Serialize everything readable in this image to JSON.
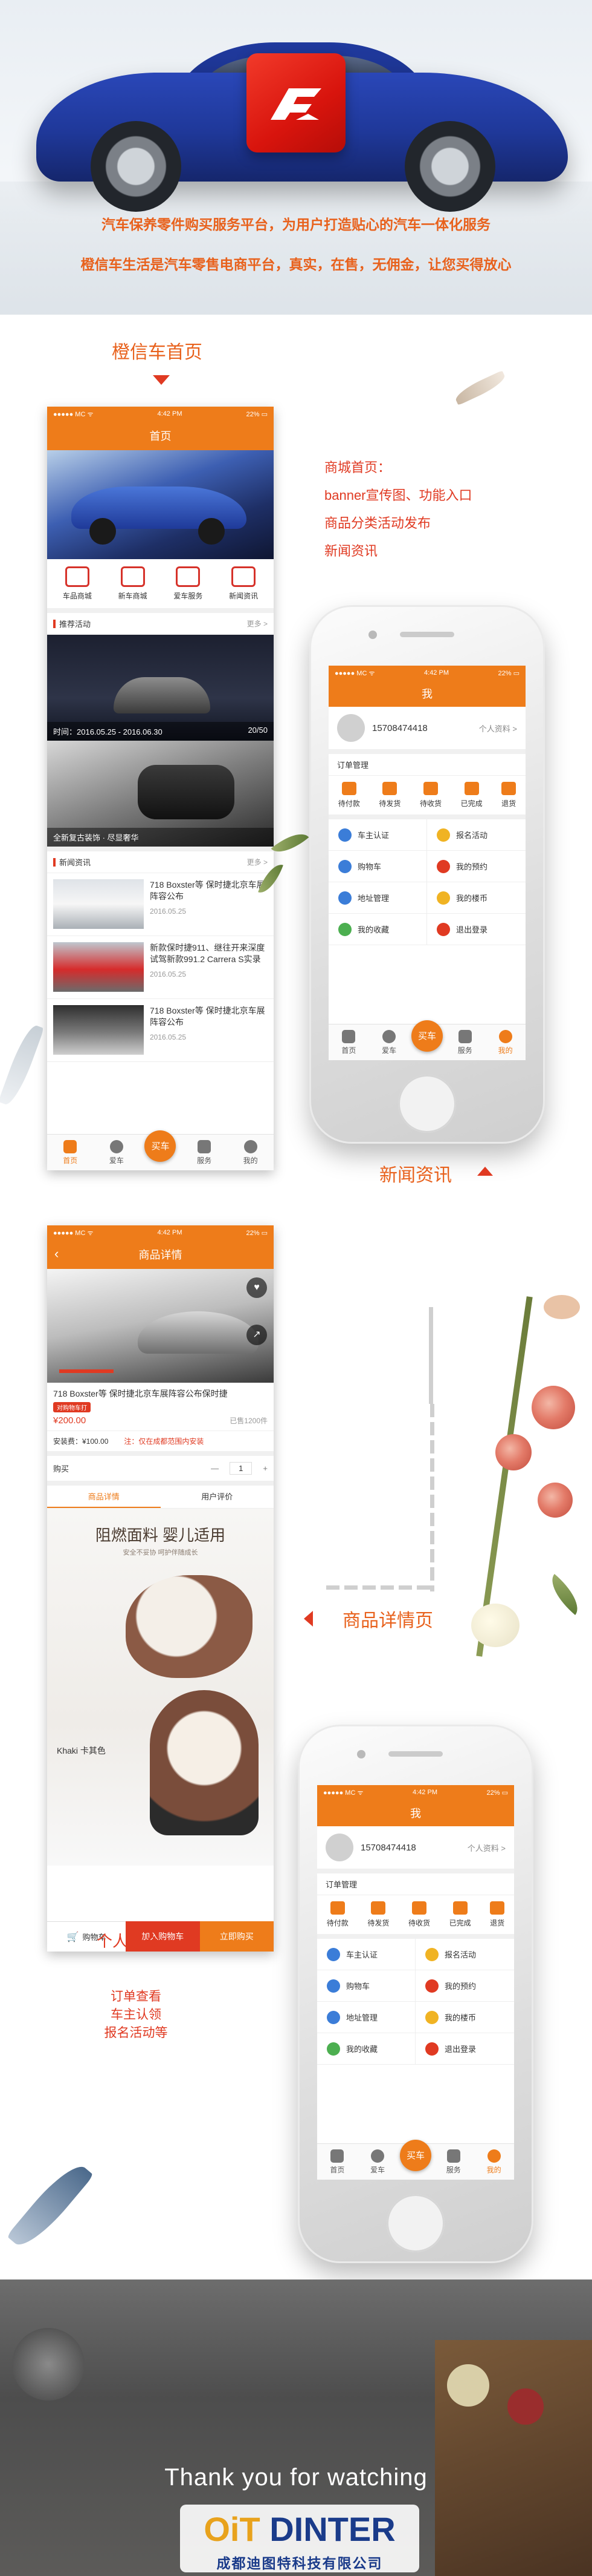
{
  "hero": {
    "line1": "汽车保养零件购买服务平台，为用户打造贴心的汽车一体化服务",
    "line2": "橙信车生活是汽车零售电商平台，真实，在售，无佣金，让您买得放心"
  },
  "section1": {
    "title": "橙信车首页",
    "desc": [
      "商城首页：",
      "banner宣传图、功能入口",
      "商品分类活动发布",
      "新闻资讯"
    ]
  },
  "home_screen": {
    "status_left": "●●●●● MC ᯤ",
    "status_time": "4:42 PM",
    "status_right": "22% ▭",
    "title": "首页",
    "quick": [
      "车品商城",
      "新车商城",
      "爱车服务",
      "新闻资讯"
    ],
    "promo_head": "推荐活动",
    "more": "更多 >",
    "promo1": {
      "caption": "时间：2016.05.25 - 2016.06.30",
      "count": "20/50"
    },
    "promo2": {
      "caption": "全新复古装饰 · 尽显奢华"
    },
    "news_head": "新闻资讯",
    "news": [
      {
        "title": "718 Boxster等 保时捷北京车展阵容公布",
        "date": "2016.05.25"
      },
      {
        "title": "新款保时捷911、继往开来深度试驾新款991.2 Carrera S实录",
        "date": "2016.05.25"
      },
      {
        "title": "718 Boxster等 保时捷北京车展阵容公布",
        "date": "2016.05.25"
      }
    ],
    "tabs": [
      "首页",
      "爱车",
      "买车",
      "服务",
      "我的"
    ]
  },
  "section2": {
    "title": "新闻资讯"
  },
  "profile_screen": {
    "status_left": "●●●●● MC ᯤ",
    "status_time": "4:42 PM",
    "status_right": "22% ▭",
    "title": "我",
    "phone": "15708474418",
    "profile_link": "个人资料 >",
    "orders_title": "订单管理",
    "orders": [
      "待付款",
      "待发货",
      "待收货",
      "已完成",
      "退货"
    ],
    "menu": [
      "车主认证",
      "报名活动",
      "购物车",
      "我的预约",
      "地址管理",
      "我的楼币",
      "我的收藏",
      "退出登录"
    ],
    "tabs": [
      "首页",
      "爱车",
      "买车",
      "服务",
      "我的"
    ]
  },
  "detail_screen": {
    "status_left": "●●●●● MC ᯤ",
    "status_time": "4:42 PM",
    "status_right": "22% ▭",
    "title": "商品详情",
    "product_title": "718 Boxster等 保时捷北京车展阵容公布保时捷",
    "tag": "对购物车打",
    "price": "¥200.00",
    "sold": "已售1200件",
    "install_fee": "安装费：¥100.00",
    "note": "注：仅在成都范围内安装",
    "buy_label": "购买",
    "qty": "1",
    "minus": "—",
    "plus": "+",
    "tab_detail": "商品详情",
    "tab_review": "用户评价",
    "ad_heading": "阻燃面料 婴儿适用",
    "ad_sub": "安全不妥协 呵护伴随成长",
    "ad_khaki": "Khaki 卡其色",
    "cart": "购物车",
    "add_cart": "加入购物车",
    "buy_now": "立即购买"
  },
  "section3": {
    "title": "商品详情页",
    "cart_note_overlay": "个人中心",
    "notes": [
      "订单查看",
      "车主认领",
      "报名活动等"
    ]
  },
  "footer": {
    "thanks": "Thank you for watching",
    "brand_prefix": "OiT",
    "brand": "DINTER",
    "company": "成都迪图特科技有限公司"
  },
  "colors": {
    "accent": "#ee7c1a",
    "red": "#e03a22"
  }
}
